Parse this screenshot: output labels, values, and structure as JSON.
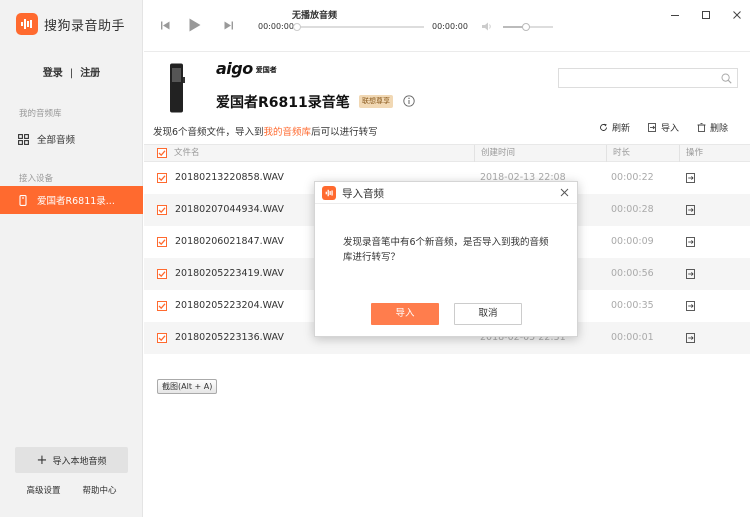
{
  "app": {
    "name": "搜狗录音助手"
  },
  "auth": {
    "login": "登录",
    "separator": "|",
    "register": "注册"
  },
  "sidebar": {
    "library_label": "我的音频库",
    "all_audio": "全部音频",
    "devices_label": "接入设备",
    "device_item": "爱国者R6811录...",
    "import_local": "导入本地音频",
    "advanced_settings": "高级设置",
    "help_center": "帮助中心"
  },
  "player": {
    "now_playing": "无播放音频",
    "current_time": "00:00:00",
    "total_time": "00:00:00",
    "progress": 0,
    "volume": 0.45
  },
  "device": {
    "brand_word": "aigo",
    "brand_cn": "爱国者",
    "name": "爱国者R6811录音笔",
    "badge": "联想尊享"
  },
  "search": {
    "placeholder": ""
  },
  "found": {
    "prefix": "发现6个音频文件，导入到",
    "link": "我的音频库",
    "suffix": "后可以进行转写"
  },
  "toolbar": {
    "refresh": "刷新",
    "import": "导入",
    "delete": "删除"
  },
  "table": {
    "columns": [
      "文件名",
      "创建时间",
      "时长",
      "操作"
    ],
    "rows": [
      {
        "filename": "20180213220858.WAV",
        "created": "2018-02-13 22:08",
        "duration": "00:00:22"
      },
      {
        "filename": "20180207044934.WAV",
        "created": "",
        "duration": "00:00:28"
      },
      {
        "filename": "20180206021847.WAV",
        "created": "",
        "duration": "00:00:09"
      },
      {
        "filename": "20180205223419.WAV",
        "created": "",
        "duration": "00:00:56"
      },
      {
        "filename": "20180205223204.WAV",
        "created": "",
        "duration": "00:00:35"
      },
      {
        "filename": "20180205223136.WAV",
        "created": "2018-02-05 22:31",
        "duration": "00:00:01"
      }
    ]
  },
  "screenshot_hint": "截图(Alt + A)",
  "modal": {
    "title": "导入音频",
    "message": "发现录音笔中有6个新音频，是否导入到我的音频库进行转写？",
    "confirm": "导入",
    "cancel": "取消"
  },
  "colors": {
    "accent": "#ff6a2f",
    "button": "#ff7d4d"
  }
}
